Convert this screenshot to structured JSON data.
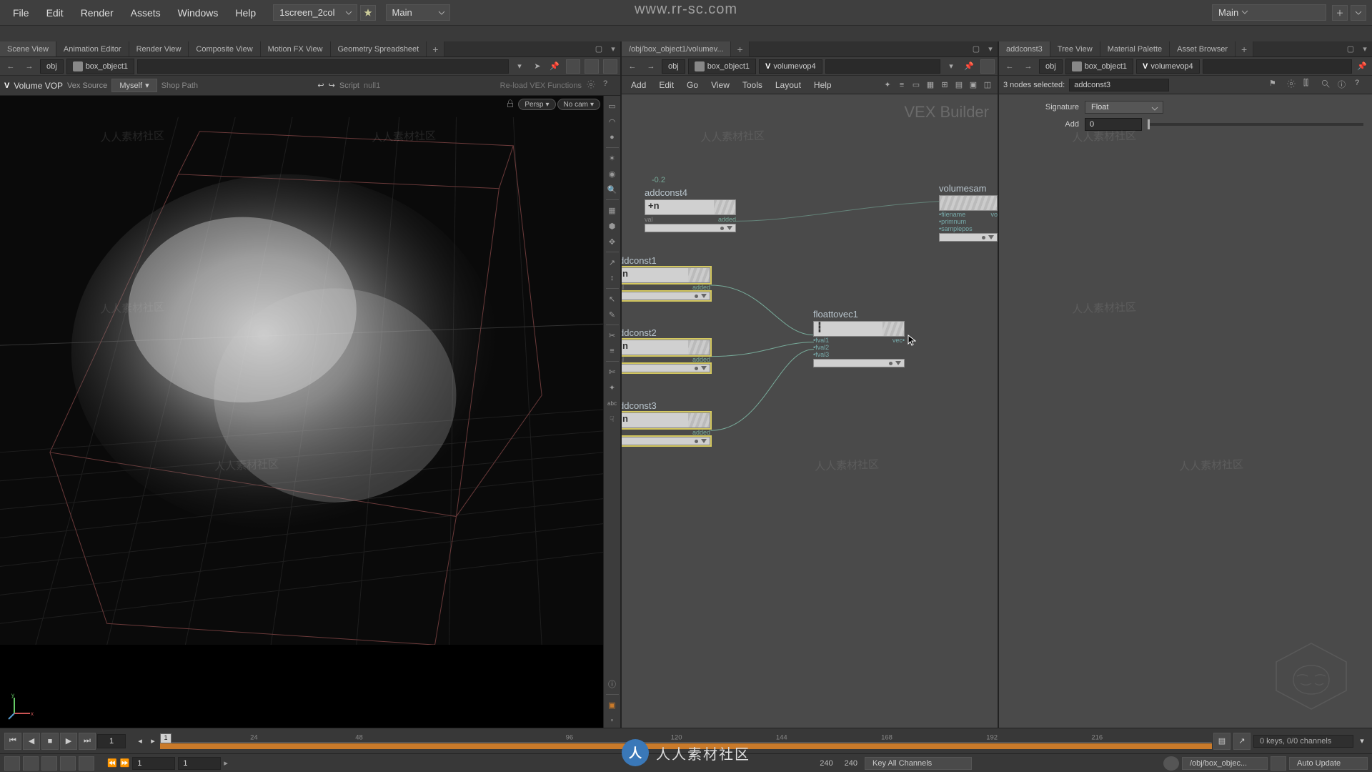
{
  "watermark_url": "www.rr-sc.com",
  "watermark_text": "人人素材社区",
  "menubar": {
    "items": [
      "File",
      "Edit",
      "Render",
      "Assets",
      "Windows",
      "Help"
    ],
    "desktop": "1screen_2col",
    "shelf_menu": "Main",
    "right_menu": "Main"
  },
  "left_pane": {
    "tabs": [
      "Scene View",
      "Animation Editor",
      "Render View",
      "Composite View",
      "Motion FX View",
      "Geometry Spreadsheet"
    ],
    "active_tab": 0,
    "path": {
      "root": "obj",
      "items": [
        "box_object1"
      ]
    },
    "opbar": {
      "icon_text": "V",
      "title": "Volume VOP",
      "subtitle": "Vex Source",
      "scope_btn": "Myself",
      "shop_path": "Shop Path",
      "script": "Script",
      "op_null": "null1",
      "reload": "Re-load VEX Functions"
    },
    "viewport": {
      "persp": "Persp",
      "nocam": "No cam"
    }
  },
  "net_pane": {
    "tabs": [
      "/obj/box_object1/volumev..."
    ],
    "path": {
      "root": "obj",
      "items": [
        "box_object1",
        "volumevop4"
      ]
    },
    "menu": [
      "Add",
      "Edit",
      "Go",
      "View",
      "Tools",
      "Layout",
      "Help"
    ],
    "builder": "VEX Builder",
    "nodes": {
      "addconst4": {
        "label": "addconst4",
        "glyph": "+n",
        "top_num": "-0.2",
        "ports_l": "val",
        "ports_r": "added",
        "sel": false
      },
      "ddconst1": {
        "label": "ddconst1",
        "glyph": "n",
        "ports_l": "al",
        "ports_r": "added",
        "sel": true
      },
      "ddconst2": {
        "label": "ddconst2",
        "glyph": "n",
        "ports_l": "al",
        "ports_r": "added",
        "sel": true
      },
      "ddconst3": {
        "label": "ddconst3",
        "glyph": "n",
        "ports_l": "",
        "ports_r": "added",
        "sel": true
      },
      "floattovec1": {
        "label": "floattovec1",
        "glyph": "",
        "ports": [
          "fval1",
          "fval2",
          "fval3"
        ],
        "out": "vec",
        "sel": false
      },
      "volumesam": {
        "label": "volumesam",
        "ports": [
          "filename",
          "primnum",
          "samplepos"
        ],
        "out": "vo",
        "sel": false
      }
    }
  },
  "param_pane": {
    "tabs": [
      "addconst3",
      "Tree View",
      "Material Palette",
      "Asset Browser"
    ],
    "active_tab": 0,
    "path": {
      "root": "obj",
      "items": [
        "box_object1",
        "volumevop4"
      ]
    },
    "selected_info": "3 nodes selected:",
    "selected_node": "addconst3",
    "params": {
      "signature": {
        "label": "Signature",
        "value": "Float"
      },
      "add": {
        "label": "Add",
        "value": "0"
      }
    }
  },
  "timeline": {
    "frame": "1",
    "head": "1",
    "ticks": [
      "24",
      "48",
      "",
      "96",
      "",
      "144",
      "",
      "192",
      "",
      ""
    ],
    "tick_centers": [
      "120",
      "168",
      "216"
    ],
    "keys_info": "0 keys, 0/0 channels",
    "range_start": "1",
    "range_start2": "1",
    "range_end": "240",
    "range_end2": "240",
    "key_all": "Key All Channels"
  },
  "botbar": {
    "cook_path": "/obj/box_objec...",
    "auto_update": "Auto Update"
  }
}
